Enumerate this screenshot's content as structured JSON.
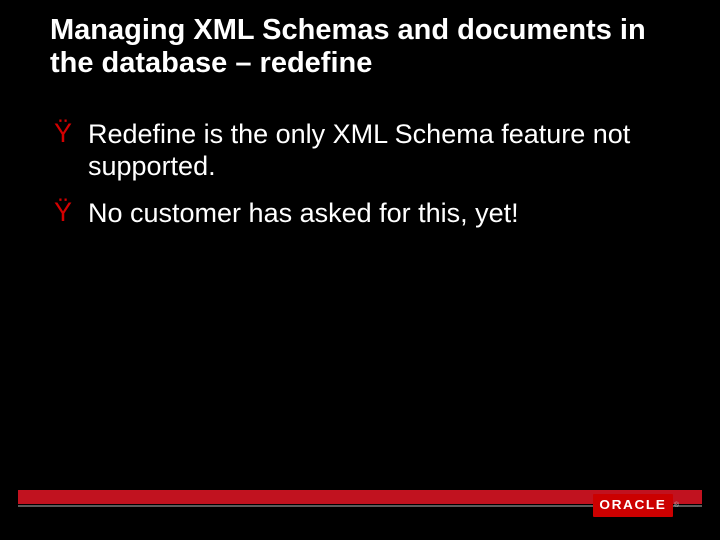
{
  "title": "Managing XML Schemas and documents in the database – redefine",
  "bullets": [
    {
      "marker": "Ÿ",
      "text": "Redefine is the only XML Schema feature not supported."
    },
    {
      "marker": "Ÿ",
      "text": "No customer has asked for this, yet!"
    }
  ],
  "logo": {
    "text": "ORACLE",
    "tm": "®"
  },
  "colors": {
    "accent": "#d40000",
    "bar": "#c1121f",
    "bg": "#000"
  }
}
